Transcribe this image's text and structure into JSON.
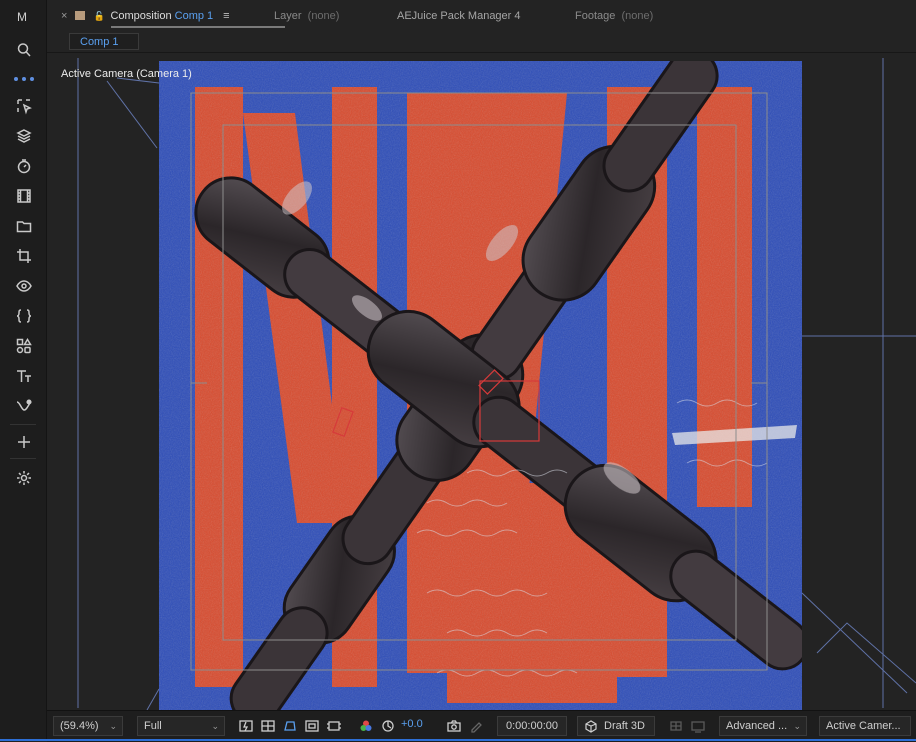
{
  "toolbar": {
    "top_label": "M",
    "tools": [
      {
        "name": "search-icon"
      },
      {
        "name": "selection-tool-icon"
      },
      {
        "name": "layers-icon"
      },
      {
        "name": "timer-icon"
      },
      {
        "name": "film-icon"
      },
      {
        "name": "folder-icon"
      },
      {
        "name": "crop-icon"
      },
      {
        "name": "eye-icon"
      },
      {
        "name": "braces-icon"
      },
      {
        "name": "shapes-icon"
      },
      {
        "name": "text-tool-icon"
      },
      {
        "name": "pen-curve-icon"
      },
      {
        "name": "plus-icon"
      },
      {
        "name": "settings-icon"
      }
    ]
  },
  "tabs": {
    "composition": {
      "close": "×",
      "label": "Composition",
      "comp_name": "Comp 1",
      "menu": "≡"
    },
    "layer": {
      "label": "Layer",
      "suffix": "(none)"
    },
    "aejuice": {
      "label": "AEJuice Pack Manager 4"
    },
    "footage": {
      "label": "Footage",
      "suffix": "(none)"
    }
  },
  "subtab": {
    "label": "Comp 1"
  },
  "viewer": {
    "camera_label": "Active Camera (Camera 1)"
  },
  "bottom_bar": {
    "zoom": "(59.4%)",
    "resolution": "Full",
    "exposure": "+0.0",
    "timecode": "0:00:00:00",
    "renderer": "Draft 3D",
    "advanced": "Advanced ...",
    "camera": "Active Camer..."
  },
  "colors": {
    "accent_blue": "#5aa0f0",
    "artwork_blue": "#2b4bb8",
    "artwork_red": "#d8492c",
    "selection_red": "#d63a3a"
  }
}
